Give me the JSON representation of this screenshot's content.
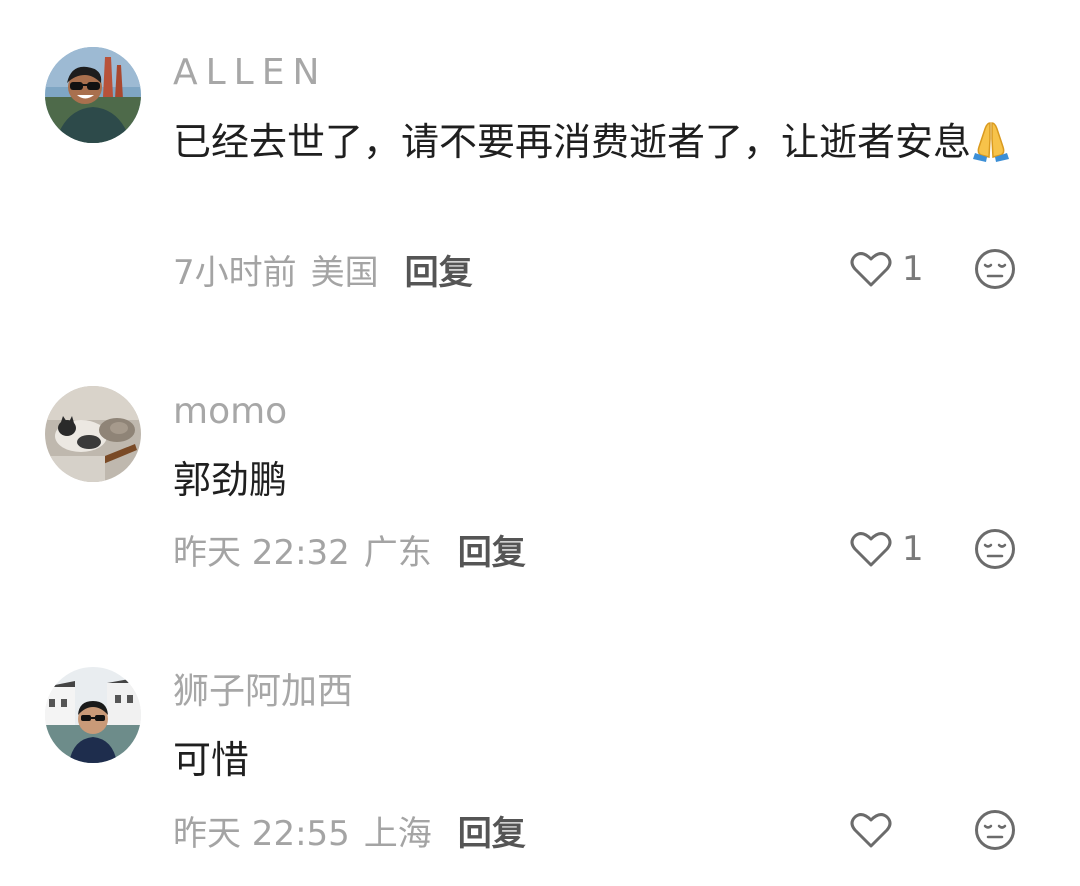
{
  "comments": [
    {
      "username": "ALLEN",
      "text": "已经去世了，请不要再消费逝者了，让逝者安息",
      "emoji": "folded-hands",
      "time": "7小时前",
      "location": "美国",
      "reply_label": "回复",
      "like_count": "1"
    },
    {
      "username": "momo",
      "text": "郭劲鹏",
      "time": "昨天 22:32",
      "location": "广东",
      "reply_label": "回复",
      "like_count": "1"
    },
    {
      "username": "狮子阿加西",
      "text": "可惜",
      "time": "昨天 22:55",
      "location": "上海",
      "reply_label": "回复",
      "like_count": ""
    }
  ],
  "icons": {
    "like": "heart-outline-icon",
    "dislike": "neutral-face-icon"
  },
  "colors": {
    "username": "#a7a7a7",
    "meta": "#a4a4a4",
    "reply": "#555555",
    "text": "#1f1f1f",
    "icon": "#6b6b6b"
  }
}
